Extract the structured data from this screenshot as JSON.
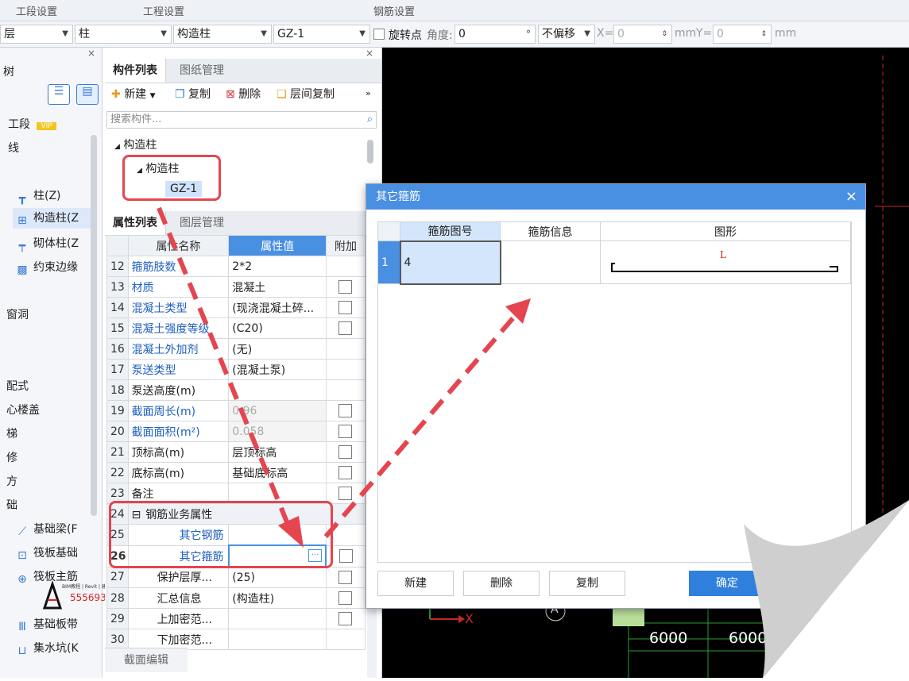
{
  "top_strip": {
    "item1": "工段设置",
    "item2": "工程设置",
    "item3": "钢筋设置"
  },
  "toolbar": {
    "floor": "层",
    "type": "柱",
    "subtype": "构造柱",
    "component": "GZ-1",
    "rotate_label": "旋转点",
    "angle_label": "角度:",
    "angle_value": "0",
    "angle_unit": "°",
    "offset_mode": "不偏移",
    "x_label": "X=",
    "x_value": "0",
    "x_unit": "mm",
    "y_label": "Y=",
    "y_value": "0",
    "y_unit": "mm"
  },
  "left_nav": {
    "items": [
      {
        "label": "树",
        "icon": ""
      },
      {
        "label": "工段",
        "badge": "VIP",
        "icon": ""
      },
      {
        "label": "线",
        "icon": ""
      },
      {
        "label": "柱(Z)",
        "icon": "column-icon"
      },
      {
        "label": "构造柱(Z",
        "icon": "construct-column-icon"
      },
      {
        "label": "砌体柱(Z",
        "icon": "masonry-column-icon"
      },
      {
        "label": "约束边缘",
        "icon": "edge-icon"
      },
      {
        "label": "窗洞",
        "icon": ""
      },
      {
        "label": "配式",
        "icon": ""
      },
      {
        "label": "心楼盖",
        "icon": ""
      },
      {
        "label": "梯",
        "icon": ""
      },
      {
        "label": "修",
        "icon": ""
      },
      {
        "label": "方",
        "icon": ""
      },
      {
        "label": "础",
        "icon": ""
      },
      {
        "label": "基础梁(F",
        "icon": "foundation-beam-icon"
      },
      {
        "label": "筏板基础",
        "icon": "raft-icon"
      },
      {
        "label": "筏板主筋",
        "icon": "raft-rebar-icon"
      },
      {
        "label": "基础板带",
        "icon": "strip-icon"
      },
      {
        "label": "集水坑(K",
        "icon": "sump-icon"
      }
    ]
  },
  "component_panel": {
    "tabs": [
      "构件列表",
      "图纸管理"
    ],
    "buttons": [
      "新建",
      "复制",
      "删除",
      "层间复制"
    ],
    "search_placeholder": "搜索构件...",
    "tree": {
      "root": "构造柱",
      "child": "构造柱",
      "leaf": "GZ-1"
    }
  },
  "property_panel": {
    "tabs": [
      "属性列表",
      "图层管理"
    ],
    "headers": [
      "属性名称",
      "属性值",
      "附加"
    ],
    "rows": [
      {
        "num": "12",
        "name": "箍筋肢数",
        "value": "2*2",
        "blue": true,
        "check": false,
        "greyed": false
      },
      {
        "num": "13",
        "name": "材质",
        "value": "混凝土",
        "blue": true,
        "check": true,
        "greyed": false
      },
      {
        "num": "14",
        "name": "混凝土类型",
        "value": "(现浇混凝土碎...",
        "blue": true,
        "check": true,
        "greyed": false
      },
      {
        "num": "15",
        "name": "混凝土强度等级",
        "value": "(C20)",
        "blue": true,
        "check": true,
        "greyed": false
      },
      {
        "num": "16",
        "name": "混凝土外加剂",
        "value": "(无)",
        "blue": true,
        "check": false,
        "greyed": false
      },
      {
        "num": "17",
        "name": "泵送类型",
        "value": "(混凝土泵)",
        "blue": true,
        "check": false,
        "greyed": false
      },
      {
        "num": "18",
        "name": "泵送高度(m)",
        "value": "",
        "blue": false,
        "check": false,
        "greyed": false
      },
      {
        "num": "19",
        "name": "截面周长(m)",
        "value": "0.96",
        "blue": true,
        "check": true,
        "greyed": true
      },
      {
        "num": "20",
        "name": "截面面积(m²)",
        "value": "0.058",
        "blue": true,
        "check": true,
        "greyed": true
      },
      {
        "num": "21",
        "name": "顶标高(m)",
        "value": "层顶标高",
        "blue": false,
        "check": true,
        "greyed": false
      },
      {
        "num": "22",
        "name": "底标高(m)",
        "value": "基础底标高",
        "blue": false,
        "check": true,
        "greyed": false
      },
      {
        "num": "23",
        "name": "备注",
        "value": "",
        "blue": false,
        "check": true,
        "greyed": false
      },
      {
        "num": "24",
        "name": "钢筋业务属性",
        "value": "",
        "group": true
      },
      {
        "num": "25",
        "name": "其它钢筋",
        "value": "",
        "blue": true,
        "sub": true,
        "check": false
      },
      {
        "num": "26",
        "name": "其它箍筋",
        "value": "",
        "blue": true,
        "sub": true,
        "check": true,
        "editing": true
      },
      {
        "num": "27",
        "name": "保护层厚...",
        "value": "(25)",
        "blue": false,
        "sub": true,
        "check": true
      },
      {
        "num": "28",
        "name": "汇总信息",
        "value": "(构造柱)",
        "blue": false,
        "sub": true,
        "check": true
      },
      {
        "num": "29",
        "name": "上加密范...",
        "value": "",
        "blue": false,
        "sub": true,
        "check": true
      },
      {
        "num": "30",
        "name": "下加密范...",
        "value": "",
        "blue": false,
        "sub": true,
        "check": false
      }
    ],
    "bottom_tab": "截面编辑"
  },
  "dialog": {
    "title": "其它箍筋",
    "headers": [
      "箍筋图号",
      "箍筋信息",
      "图形"
    ],
    "row": {
      "num": "1",
      "shape_no": "4",
      "info": "",
      "shape_label": "L"
    },
    "buttons": {
      "new": "新建",
      "delete": "删除",
      "copy": "复制",
      "ok": "确定"
    }
  },
  "canvas": {
    "axis_a": "A",
    "dim1": "6000",
    "dim2": "6000",
    "axis_x": "X"
  },
  "watermark": {
    "line1": "BIM教程 | Revit | 建",
    "line2": "555693"
  },
  "colors": {
    "accent": "#4a90e2",
    "annotation": "#e5454f",
    "canvas": "#000000",
    "link_blue": "#1f5fbf"
  }
}
